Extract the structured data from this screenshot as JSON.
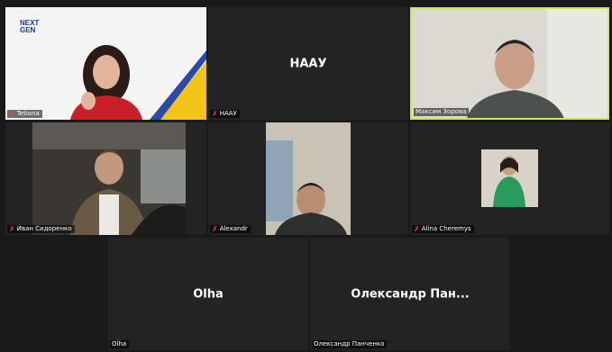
{
  "participants": [
    {
      "name": "Tetiana",
      "muted": true
    },
    {
      "name": "НААУ",
      "display_text": "НААУ",
      "muted": true
    },
    {
      "name": "Максим Зорова",
      "muted": false,
      "active_speaker": true
    },
    {
      "name": "Иван Сидоренко",
      "muted": true
    },
    {
      "name": "Alexandr",
      "muted": true
    },
    {
      "name": "Alina Cheremys",
      "muted": true
    },
    {
      "name": "Olha",
      "display_text": "Olha",
      "muted": false
    },
    {
      "name": "Олександр Панченко",
      "display_text": "Олександр Пан...",
      "muted": false
    }
  ],
  "logo": {
    "line1": "NEXT",
    "line2": "GEN"
  },
  "colors": {
    "active_border": "#c9e65f",
    "muted_mic": "#e8453c",
    "tile_bg": "#232323"
  },
  "icons": {
    "muted": "microphone-muted-icon"
  }
}
